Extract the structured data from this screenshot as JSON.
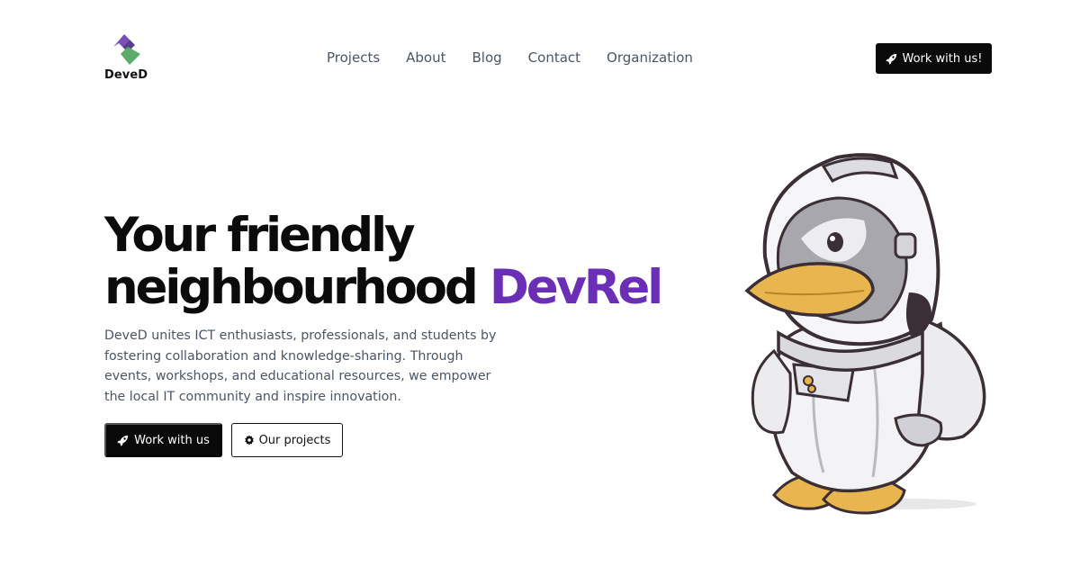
{
  "brand": {
    "name": "DeveD",
    "colors": {
      "purple": "#6a2fb5",
      "green": "#5cab6b"
    }
  },
  "nav": {
    "items": [
      {
        "label": "Projects"
      },
      {
        "label": "About"
      },
      {
        "label": "Blog"
      },
      {
        "label": "Contact"
      },
      {
        "label": "Organization"
      }
    ]
  },
  "header": {
    "cta_label": "Work with us!",
    "cta_icon": "rocket-icon"
  },
  "hero": {
    "title_line1": "Your friendly",
    "title_line2_prefix": "neighbourhood",
    "title_accent": "DevRel",
    "description": "DeveD unites ICT enthusiasts, professionals, and students by fostering collaboration and knowledge-sharing. Through events, workshops, and educational resources, we empower the local IT community and inspire innovation.",
    "primary_button": {
      "label": "Work with us",
      "icon": "rocket-icon"
    },
    "secondary_button": {
      "label": "Our projects",
      "icon": "gear-icon"
    }
  },
  "mascot": {
    "icon": "astronaut-duck-illustration"
  }
}
